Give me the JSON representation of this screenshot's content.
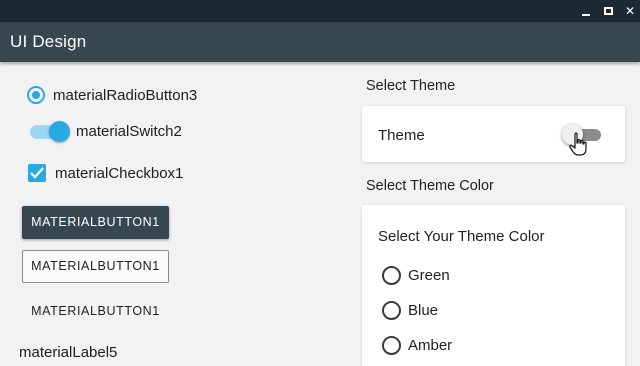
{
  "window": {
    "controls": [
      {
        "name": "minimize-icon",
        "glyph": ""
      },
      {
        "name": "maximize-icon",
        "glyph": ""
      },
      {
        "name": "close-icon",
        "glyph": "✕"
      }
    ]
  },
  "appbar": {
    "title": "UI Design"
  },
  "controls": {
    "radio_label": "materialRadioButton3",
    "switch_label": "materialSwitch2",
    "checkbox_label": "materialCheckbox1",
    "button_filled": "MATERIALBUTTON1",
    "button_outlined": "MATERIALBUTTON1",
    "button_text": "MATERIALBUTTON1",
    "label": "materialLabel5"
  },
  "theme_panel": {
    "heading": "Select Theme",
    "card_label": "Theme",
    "toggle_on": false
  },
  "color_panel": {
    "heading": "Select Theme Color",
    "card_title": "Select Your Theme Color",
    "options": [
      "Green",
      "Blue",
      "Amber"
    ]
  },
  "colors": {
    "accent": "#29a9e1",
    "appbar": "#36474f",
    "titlebar": "#1d2a33",
    "background": "#f2f2f2"
  }
}
